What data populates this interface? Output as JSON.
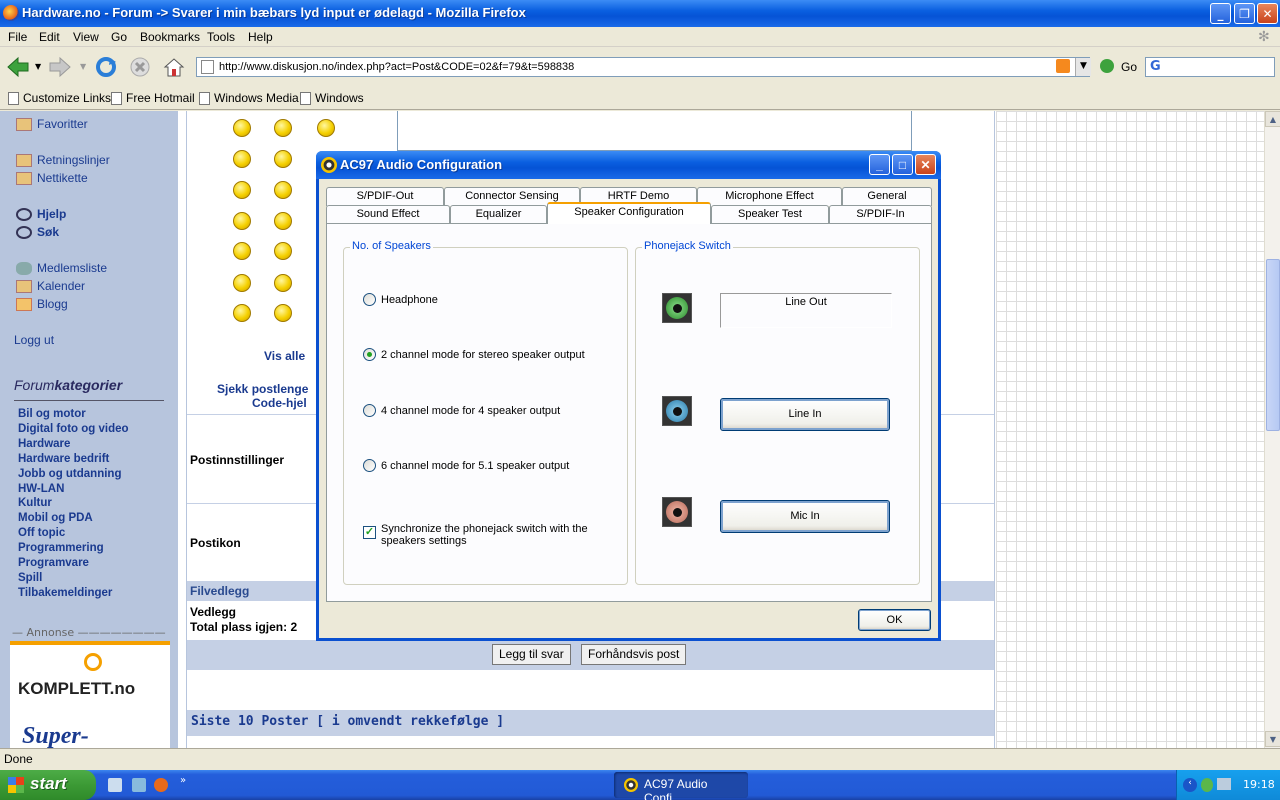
{
  "browser": {
    "title": "Hardware.no - Forum -> Svarer i min bæbars lyd input er ødelagd - Mozilla Firefox",
    "menu": [
      "File",
      "Edit",
      "View",
      "Go",
      "Bookmarks",
      "Tools",
      "Help"
    ],
    "url": "http://www.diskusjon.no/index.php?act=Post&CODE=02&f=79&t=598838",
    "go_label": "Go",
    "search_engine_label": "G",
    "bookmarks": [
      "Customize Links",
      "Free Hotmail",
      "Windows Media",
      "Windows"
    ],
    "status": "Done"
  },
  "sidebar": {
    "links": [
      "Favoritter",
      "Retningslinjer",
      "Nettikette",
      "Hjelp",
      "Søk",
      "Medlemsliste",
      "Kalender",
      "Blogg",
      "Logg ut"
    ],
    "forumkategorier_a": "Forum",
    "forumkategorier_b": "kategorier",
    "categories": [
      "Bil og motor",
      "Digital foto og video",
      "Hardware",
      "Hardware bedrift",
      "Jobb og utdanning",
      "HW-LAN",
      "Kultur",
      "Mobil og PDA",
      "Off topic",
      "Programmering",
      "Programvare",
      "Spill",
      "Tilbakemeldinger"
    ],
    "annonse": "Annonse",
    "ad_brand": "KOMPLETT.no",
    "ad_text": "Super-"
  },
  "page": {
    "vis_alle": "Vis alle",
    "sjekk": "Sjekk postlenge",
    "code_hjelp": "Code-hjel",
    "postinnstillinger": "Postinnstillinger",
    "postikon": "Postikon",
    "filvedlegg": "Filvedlegg",
    "vedlegg": "Vedlegg",
    "total_plass": "Total plass igjen: 2",
    "btn_add": "Legg til svar",
    "btn_preview": "Forhåndsvis post",
    "siste_10": "Siste 10 Poster [ i omvendt rekkefølge ]"
  },
  "dialog": {
    "title": "AC97 Audio Configuration",
    "tabs_back": [
      "S/PDIF-Out",
      "Connector Sensing",
      "HRTF Demo",
      "Microphone Effect",
      "General"
    ],
    "tabs_front": [
      "Sound Effect",
      "Equalizer",
      "Speaker Configuration",
      "Speaker Test",
      "S/PDIF-In"
    ],
    "active_tab": "Speaker Configuration",
    "speakers_group": "No. of Speakers",
    "options": [
      "Headphone",
      "2 channel mode for stereo speaker output",
      "4 channel mode for 4 speaker output",
      "6 channel mode for 5.1 speaker output"
    ],
    "selected_option": 1,
    "sync_checkbox": "Synchronize the phonejack switch with the speakers settings",
    "sync_checked": true,
    "phonejack_group": "Phonejack Switch",
    "line_out": "Line Out",
    "line_in": "Line In",
    "mic_in": "Mic In",
    "ok": "OK"
  },
  "taskbar": {
    "start": "start",
    "task": "AC97 Audio Confi...",
    "clock": "19:18"
  }
}
